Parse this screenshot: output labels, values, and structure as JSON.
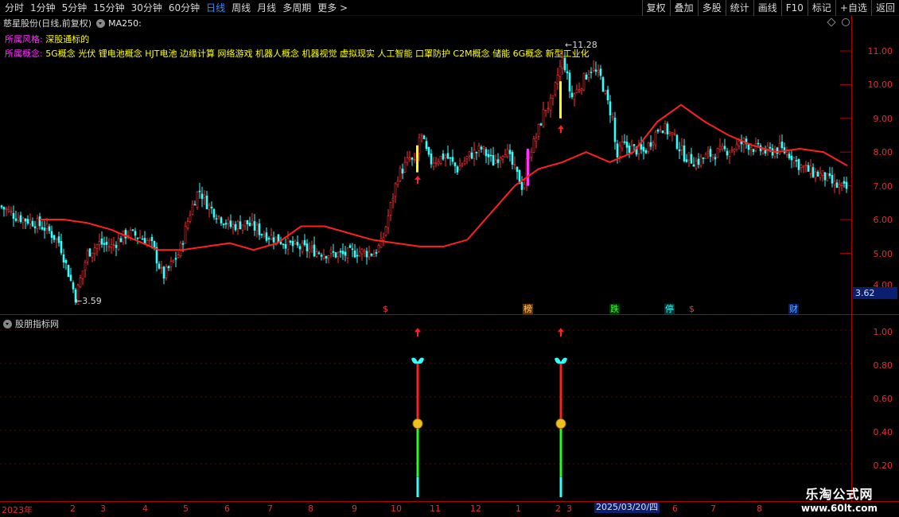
{
  "toolbar": {
    "periods": [
      "分时",
      "1分钟",
      "5分钟",
      "15分钟",
      "30分钟",
      "60分钟",
      "日线",
      "周线",
      "月线",
      "多周期",
      "更多 >"
    ],
    "active_period": "日线",
    "buttons": [
      "复权",
      "叠加",
      "多股",
      "统计",
      "画线",
      "F10",
      "标记",
      "+自选",
      "返回"
    ]
  },
  "header": {
    "stock_title": "慈星股份(日线,前复权)",
    "ma_label": "MA250:",
    "style_key": "所属风格:",
    "style_value": "深股通标的",
    "concept_key": "所属概念:",
    "concept_value": "5G概念 光伏 锂电池概念 HJT电池 边缘计算 网络游戏 机器人概念 机器视觉 虚拟现实 人工智能 口罩防护 C2M概念 储能 6G概念 新型工业化"
  },
  "price_axis": [
    "11.00",
    "10.00",
    "9.00",
    "8.00",
    "7.00",
    "6.00",
    "5.00",
    "4.00"
  ],
  "current_price_box": "3.62",
  "low_marker": "3.59",
  "high_marker": "11.28",
  "event_markers": [
    {
      "text": "$",
      "color": "#ff3333",
      "bg": "#000000"
    },
    {
      "text": "榜",
      "color": "#ffcc66",
      "bg": "#663300"
    },
    {
      "text": "跌",
      "color": "#33ff33",
      "bg": "#003300"
    },
    {
      "text": "停",
      "color": "#33ffff",
      "bg": "#003333"
    },
    {
      "text": "$",
      "color": "#ff3333",
      "bg": "#000000"
    },
    {
      "text": "财",
      "color": "#66aaff",
      "bg": "#001a66"
    }
  ],
  "indicator": {
    "title": "股朋指标网",
    "axis": [
      "1.00",
      "0.80",
      "0.60",
      "0.40",
      "0.20"
    ]
  },
  "dates": [
    "2023年",
    "2",
    "3",
    "4",
    "5",
    "6",
    "7",
    "8",
    "9",
    "10",
    "11",
    "12",
    "1",
    "2",
    "3",
    "四",
    "6",
    "7",
    "8"
  ],
  "date_highlight": "2025/03/20/四",
  "watermark": {
    "line1": "乐淘公式网",
    "line2": "www.60lt.com"
  },
  "colors": {
    "up": "#ff3333",
    "down": "#33ffff",
    "ma": "#ff2020",
    "axis": "#e03030"
  },
  "chart_data": {
    "type": "candlestick",
    "ylim": [
      3.5,
      11.5
    ],
    "series": [
      {
        "name": "MA250",
        "values": [
          6.0,
          6.0,
          5.9,
          5.7,
          5.4,
          5.1,
          5.1,
          5.2,
          5.3,
          5.1,
          5.3,
          5.8,
          5.8,
          5.6,
          5.4,
          5.3,
          5.2,
          5.2,
          5.4,
          6.2,
          7.0,
          7.5,
          7.7,
          8.0,
          7.7,
          8.0,
          8.9,
          9.4,
          8.9,
          8.5,
          8.2,
          8.0,
          8.1,
          8.0,
          7.6
        ]
      }
    ],
    "indicator_signals": [
      {
        "mid": 0.44,
        "top": 0.8,
        "arrow": 0.98
      },
      {
        "mid": 0.44,
        "top": 0.8,
        "arrow": 0.98
      }
    ]
  }
}
